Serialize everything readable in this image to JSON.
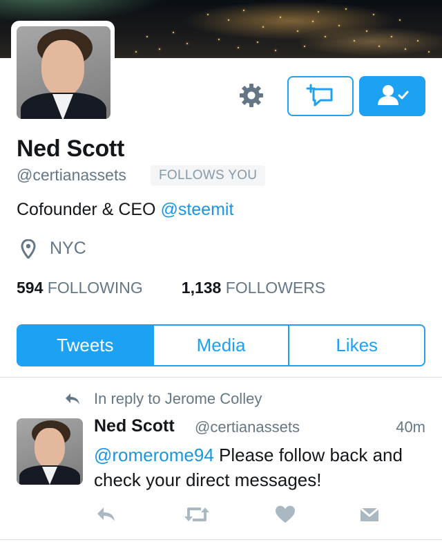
{
  "profile": {
    "name": "Ned Scott",
    "handle": "@certianassets",
    "follows_you": "FOLLOWS YOU",
    "bio_text": "Cofounder & CEO ",
    "bio_link": "@steemit",
    "location": "NYC",
    "following_count": "594",
    "following_label": "FOLLOWING",
    "followers_count": "1,138",
    "followers_label": "FOLLOWERS"
  },
  "actions": {
    "settings_icon": "gear-icon",
    "dm_icon": "compose-message-icon",
    "follow_icon": "following-user-check-icon"
  },
  "tabs": [
    {
      "label": "Tweets",
      "active": true
    },
    {
      "label": "Media",
      "active": false
    },
    {
      "label": "Likes",
      "active": false
    }
  ],
  "tweet": {
    "reply_context": "In reply to Jerome Colley",
    "author_name": "Ned Scott",
    "author_handle": "@certianassets",
    "time": "40m",
    "mention": "@romerome94",
    "text": " Please follow back and check your direct messages!",
    "actions": [
      "reply-icon",
      "retweet-icon",
      "like-heart-icon",
      "direct-message-icon"
    ]
  },
  "colors": {
    "accent": "#1da1f2",
    "link": "#1b95e0",
    "secondary_text": "#657786",
    "action_icons": "#aab8c2"
  }
}
